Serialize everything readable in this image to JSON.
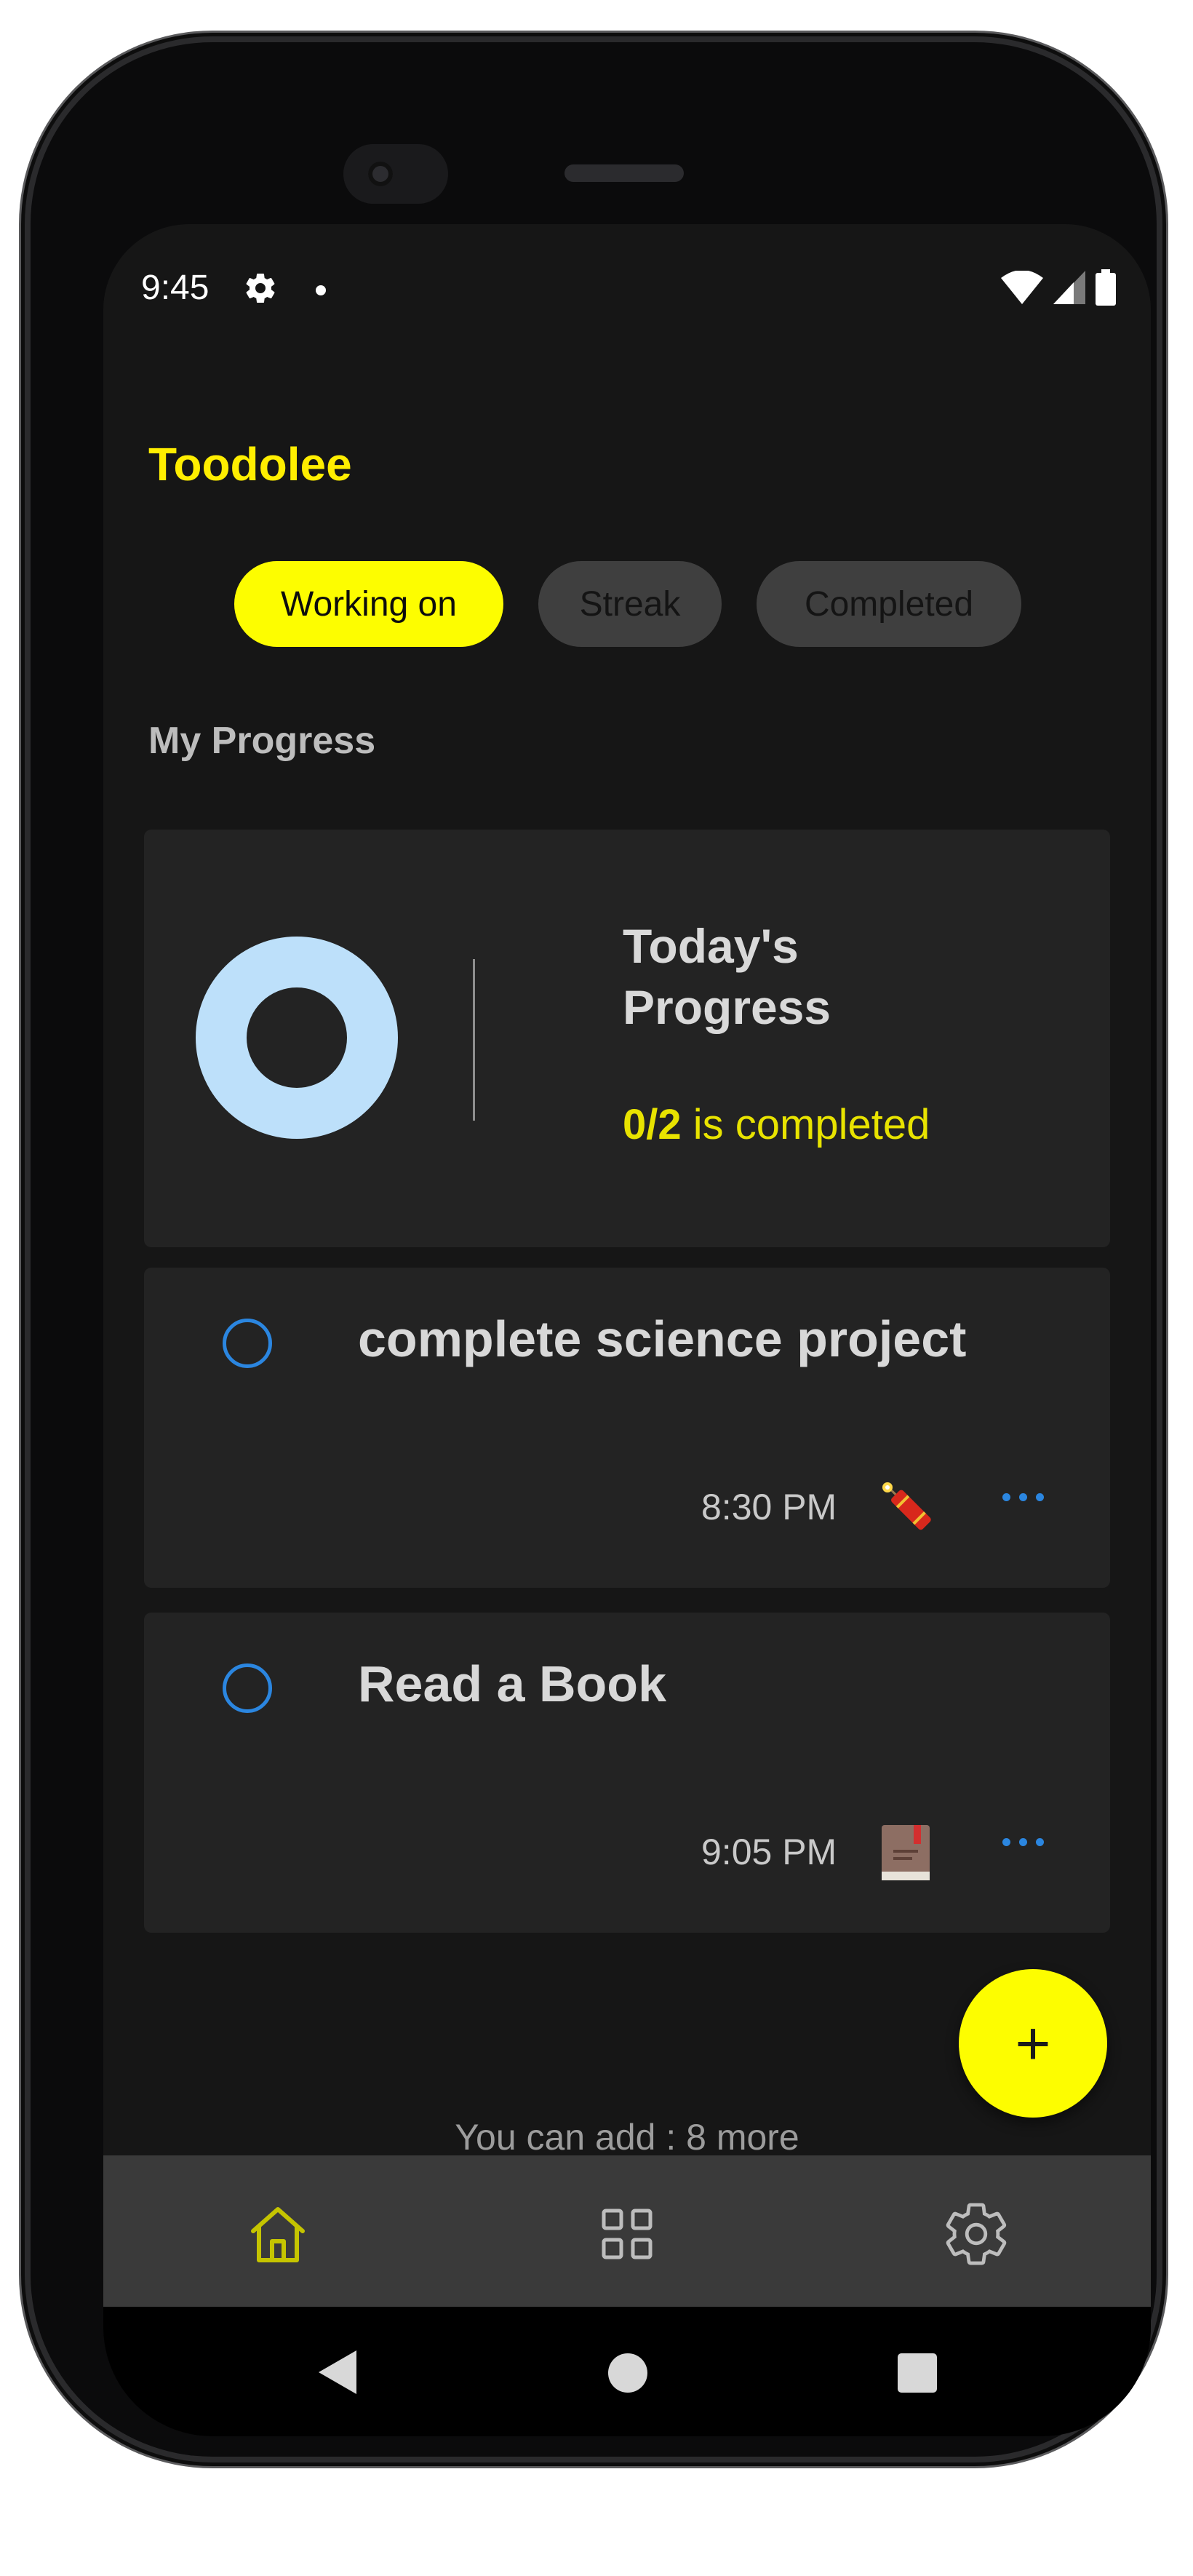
{
  "status_bar": {
    "time": "9:45"
  },
  "app": {
    "title": "Toodolee"
  },
  "tabs": [
    {
      "label": "Working on",
      "active": true
    },
    {
      "label": "Streak",
      "active": false
    },
    {
      "label": "Completed",
      "active": false
    }
  ],
  "progress": {
    "section_label": "My Progress",
    "title": "Today's Progress",
    "fraction": "0/2",
    "suffix": " is completed",
    "completed": 0,
    "total": 2
  },
  "tasks": [
    {
      "title": "complete science project",
      "time": "8:30 PM",
      "icon": "firecracker-icon"
    },
    {
      "title": "Read a Book",
      "time": "9:05 PM",
      "icon": "book-icon"
    }
  ],
  "footer": {
    "remaining_text": "You can add : 8 more"
  },
  "fab": {
    "label": "+"
  },
  "bottom_nav": {
    "items": [
      {
        "icon": "home-icon",
        "active": true
      },
      {
        "icon": "grid-icon",
        "active": false
      },
      {
        "icon": "gear-icon",
        "active": false
      }
    ]
  },
  "colors": {
    "accent": "#fdfd00",
    "background": "#161616",
    "card": "#232323",
    "check": "#2b86e0",
    "donut": "#bde0fa"
  }
}
